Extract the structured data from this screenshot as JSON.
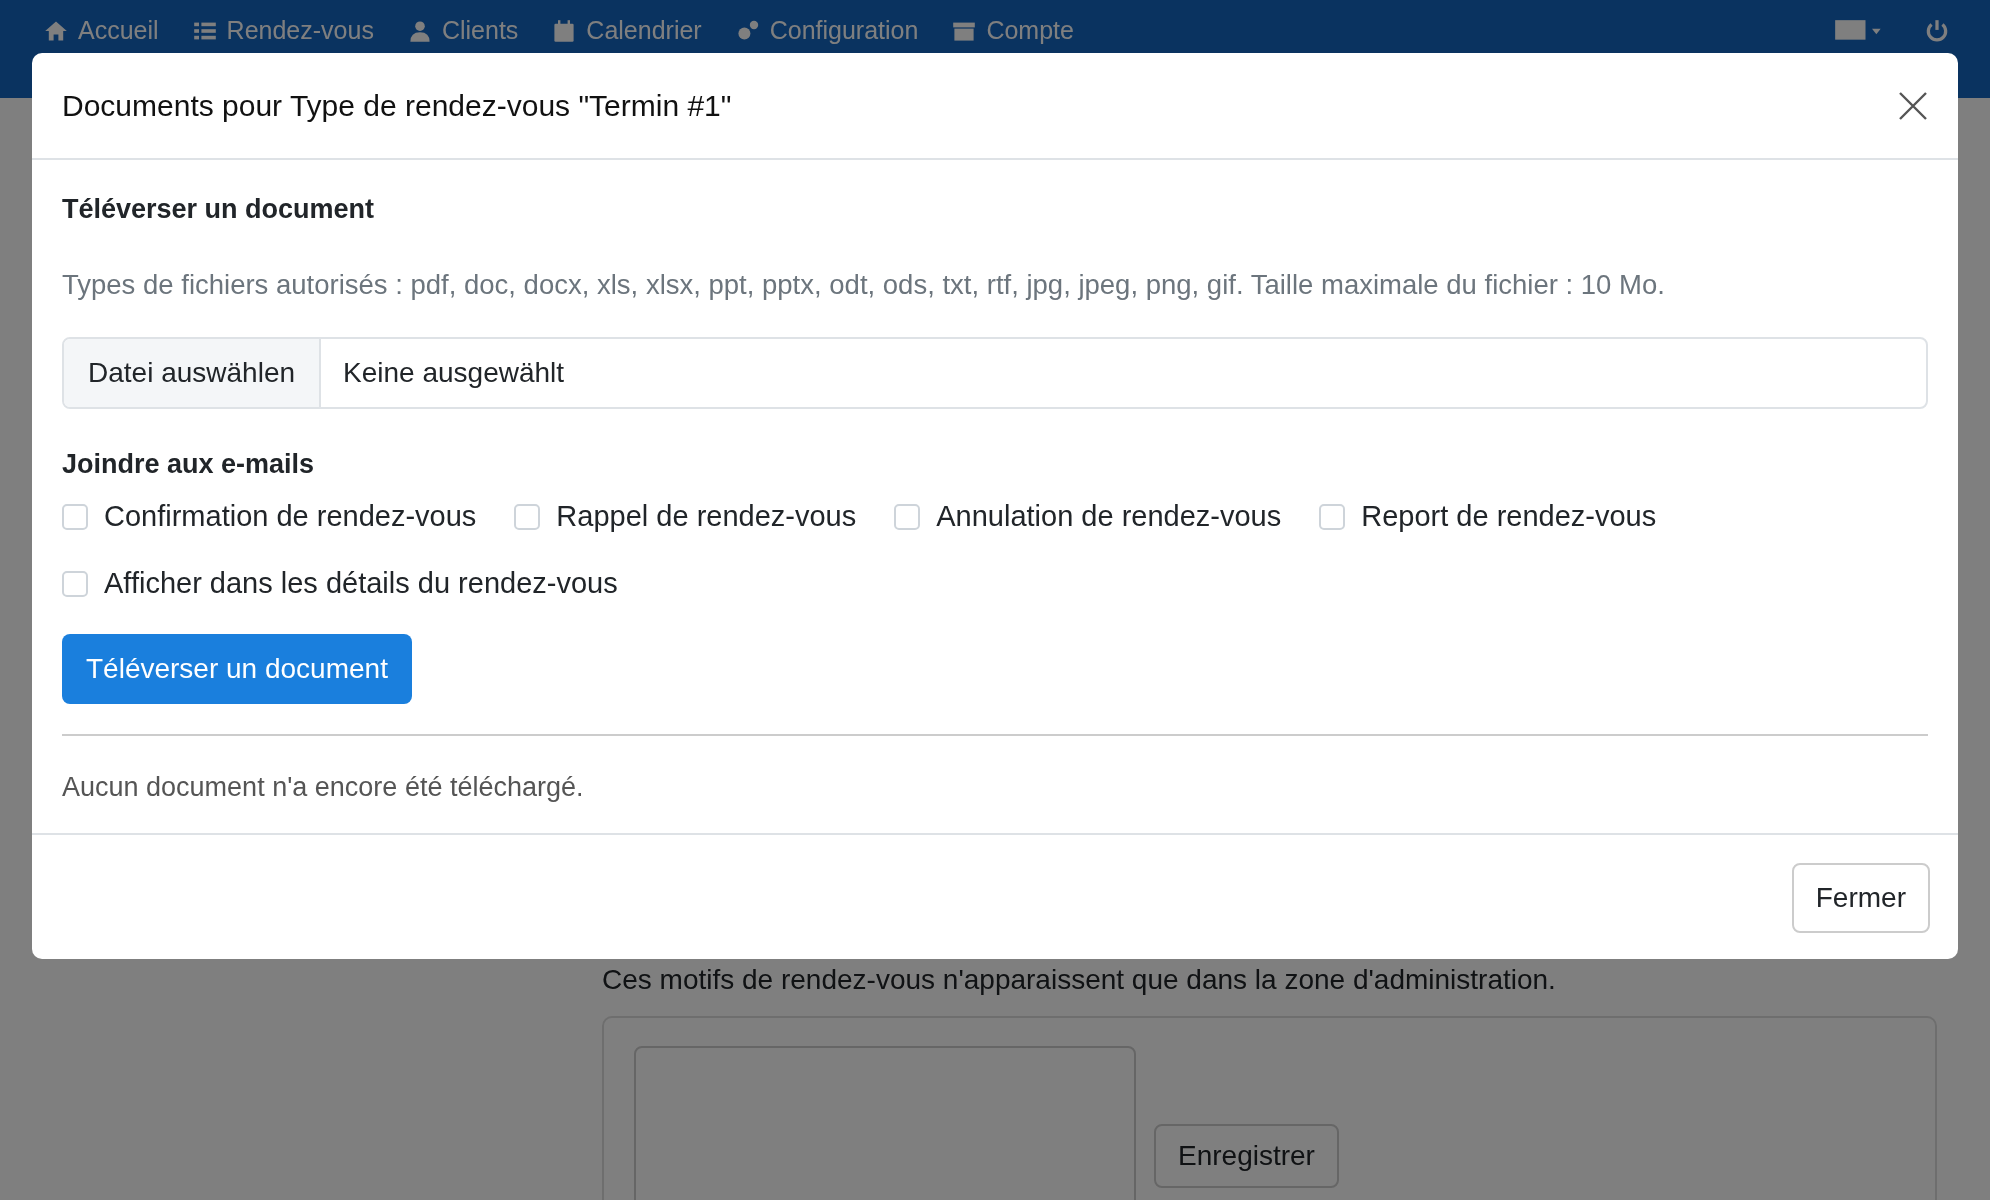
{
  "navbar": {
    "items": [
      "Accueil",
      "Rendez-vous",
      "Clients",
      "Calendrier",
      "Configuration",
      "Compte"
    ]
  },
  "page": {
    "note": "Ces motifs de rendez-vous n'apparaissent que dans la zone d'administration.",
    "save_button": "Enregistrer"
  },
  "modal": {
    "title": "Documents pour Type de rendez-vous \"Termin #1\"",
    "upload_heading": "Téléverser un document",
    "allowed_types": "Types de fichiers autorisés : pdf, doc, docx, xls, xlsx, ppt, pptx, odt, ods, txt, rtf, jpg, jpeg, png, gif. Taille maximale du fichier : 10 Mo.",
    "file_input": {
      "button": "Datei auswählen",
      "value": "Keine ausgewählt"
    },
    "attach_heading": "Joindre aux e-mails",
    "checkboxes": [
      {
        "label": "Confirmation de rendez-vous",
        "checked": false
      },
      {
        "label": "Rappel de rendez-vous",
        "checked": false
      },
      {
        "label": "Annulation de rendez-vous",
        "checked": false
      },
      {
        "label": "Report de rendez-vous",
        "checked": false
      },
      {
        "label": "Afficher dans les détails du rendez-vous",
        "checked": false
      }
    ],
    "upload_button": "Téléverser un document",
    "empty_message": "Aucun document n'a encore été téléchargé.",
    "close_button": "Fermer"
  }
}
